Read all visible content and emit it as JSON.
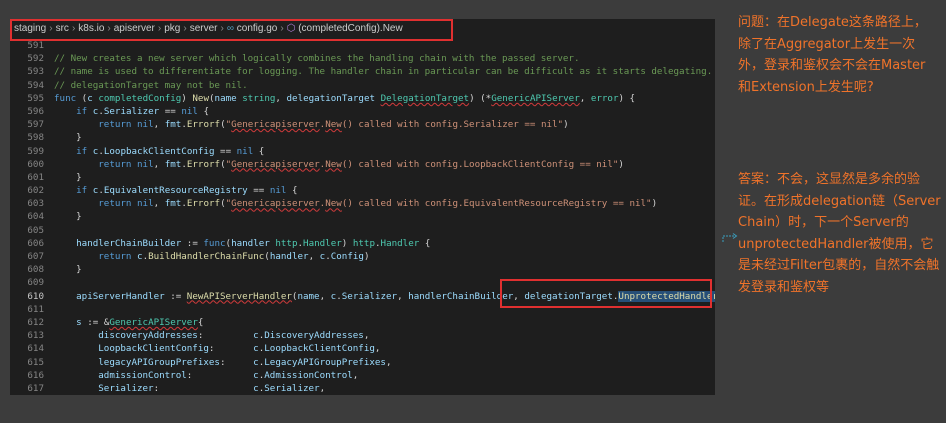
{
  "breadcrumb": {
    "items": [
      "staging",
      "src",
      "k8s.io",
      "apiserver",
      "pkg",
      "server",
      "config.go",
      "(completedConfig).New"
    ],
    "file_icon": "go-file-icon",
    "symbol_icon": "method-cube-icon"
  },
  "code": {
    "lines": [
      {
        "num": "591",
        "html": ""
      },
      {
        "num": "592",
        "html": "<span class='c'>// New creates a new server which logically combines the handling chain with the passed server.</span>"
      },
      {
        "num": "593",
        "html": "<span class='c'>// name is used to differentiate for logging. The handler chain in particular can be difficult as it starts delegating.</span>"
      },
      {
        "num": "594",
        "html": "<span class='c'>// delegationTarget may not be nil.</span>"
      },
      {
        "num": "595",
        "html": "<span class='k'>func</span> (<span class='v'>c</span> <span class='t'>completedConfig</span>) <span class='f'>New</span>(<span class='v'>name</span> <span class='t'>string</span>, <span class='v'>delegationTarget</span> <span class='t sq'>DelegationTarget</span>) (*<span class='t sq'>GenericAPIServer</span>, <span class='t'>error</span>) {"
      },
      {
        "num": "596",
        "html": "    <span class='k'>if</span> <span class='v'>c</span>.<span class='v'>Serializer</span> == <span class='n'>nil</span> {"
      },
      {
        "num": "597",
        "html": "        <span class='k'>return</span> <span class='n'>nil</span>, <span class='v'>fmt</span>.<span class='f'>Errorf</span>(<span class='s'>\"<span class='sq'>Genericapiserver</span>.<span class='sq'>New</span>() called with config.Serializer == nil\"</span>)"
      },
      {
        "num": "598",
        "html": "    }"
      },
      {
        "num": "599",
        "html": "    <span class='k'>if</span> <span class='v'>c</span>.<span class='v'>LoopbackClientConfig</span> == <span class='n'>nil</span> {"
      },
      {
        "num": "600",
        "html": "        <span class='k'>return</span> <span class='n'>nil</span>, <span class='v'>fmt</span>.<span class='f'>Errorf</span>(<span class='s'>\"<span class='sq'>Genericapiserver</span>.<span class='sq'>New</span>() called with config.LoopbackClientConfig == nil\"</span>)"
      },
      {
        "num": "601",
        "html": "    }"
      },
      {
        "num": "602",
        "html": "    <span class='k'>if</span> <span class='v'>c</span>.<span class='v'>EquivalentResourceRegistry</span> == <span class='n'>nil</span> {"
      },
      {
        "num": "603",
        "html": "        <span class='k'>return</span> <span class='n'>nil</span>, <span class='v'>fmt</span>.<span class='f'>Errorf</span>(<span class='s'>\"<span class='sq'>Genericapiserver</span>.<span class='sq'>New</span>() called with config.EquivalentResourceRegistry == nil\"</span>)"
      },
      {
        "num": "604",
        "html": "    }"
      },
      {
        "num": "605",
        "html": ""
      },
      {
        "num": "606",
        "html": "    <span class='v'>handlerChainBuilder</span> := <span class='k'>func</span>(<span class='v'>handler</span> <span class='t'>http</span>.<span class='t'>Handler</span>) <span class='t'>http</span>.<span class='t'>Handler</span> {"
      },
      {
        "num": "607",
        "html": "        <span class='k'>return</span> <span class='v'>c</span>.<span class='f'>BuildHandlerChainFunc</span>(<span class='v'>handler</span>, <span class='v'>c</span>.<span class='v'>Config</span>)"
      },
      {
        "num": "608",
        "html": "    }"
      },
      {
        "num": "609",
        "html": ""
      },
      {
        "num": "610",
        "html": "    <span class='v'>apiServerHandler</span> := <span class='f sq'>NewAPIServerHandler</span>(<span class='v'>name</span>, <span class='v'>c</span>.<span class='v'>Serializer</span>, <span class='v'>handlerChainBuilder</span>, <span class='v'>delegationTarget</span>.<span class='f hl'>UnprotectedHandler</span>())",
        "current": true
      },
      {
        "num": "611",
        "html": ""
      },
      {
        "num": "612",
        "html": "    <span class='v'>s</span> := &amp;<span class='t sq'>GenericAPIServer</span>{"
      },
      {
        "num": "613",
        "html": "        <span class='v'>discoveryAddresses</span>:         <span class='v'>c</span>.<span class='v'>DiscoveryAddresses</span>,"
      },
      {
        "num": "614",
        "html": "        <span class='v'>LoopbackClientConfig</span>:       <span class='v'>c</span>.<span class='v'>LoopbackClientConfig</span>,"
      },
      {
        "num": "615",
        "html": "        <span class='v'>legacyAPIGroupPrefixes</span>:     <span class='v'>c</span>.<span class='v'>LegacyAPIGroupPrefixes</span>,"
      },
      {
        "num": "616",
        "html": "        <span class='v'>admissionControl</span>:           <span class='v'>c</span>.<span class='v'>AdmissionControl</span>,"
      },
      {
        "num": "617",
        "html": "        <span class='v'>Serializer</span>:                 <span class='v'>c</span>.<span class='v'>Serializer</span>,"
      }
    ]
  },
  "notes": {
    "question": "问题：在Delegate这条路径上，除了在Aggregator上发生一次外，登录和鉴权会不会在Master和Extension上发生呢?",
    "answer": "答案：不会，这显然是多余的验证。在形成delegation链（Server Chain）时，下一个Server的unprotectedHandler被使用，它是未经过Filter包裹的，自然不会触发登录和鉴权等"
  },
  "colors": {
    "annotation": "#f0732a",
    "outline": "#e03030",
    "arrow": "#3a9fbf"
  }
}
